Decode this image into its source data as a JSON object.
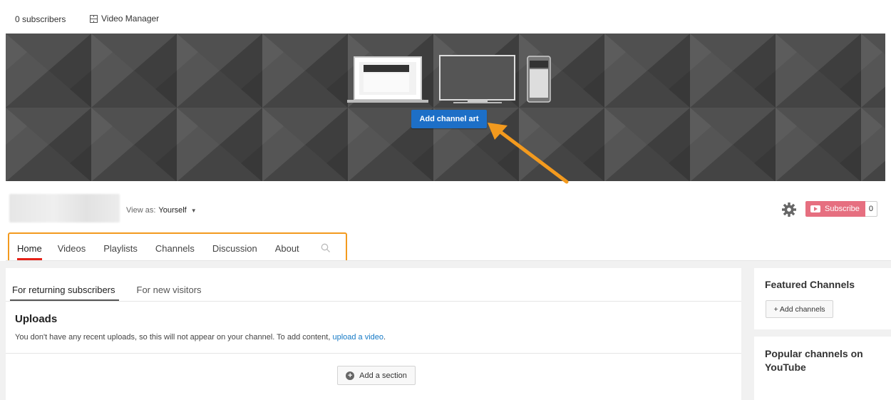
{
  "topbar": {
    "subscribers_label": "0 subscribers",
    "video_manager_label": "Video Manager",
    "video_manager_icon": "film-icon"
  },
  "banner": {
    "add_art_label": "Add channel art",
    "accent_color": "#1d6fc7",
    "devices": [
      "laptop-icon",
      "tv-icon",
      "phone-icon"
    ]
  },
  "channel": {
    "view_as_label": "View as:",
    "view_as_value": "Yourself",
    "subscribe_label": "Subscribe",
    "subscribe_count": "0",
    "subscribe_color": "#e66f80"
  },
  "tabs": [
    {
      "label": "Home",
      "active": true
    },
    {
      "label": "Videos"
    },
    {
      "label": "Playlists"
    },
    {
      "label": "Channels"
    },
    {
      "label": "Discussion"
    },
    {
      "label": "About"
    }
  ],
  "subtabs": [
    {
      "label": "For returning subscribers",
      "active": true
    },
    {
      "label": "For new visitors"
    }
  ],
  "uploads": {
    "title": "Uploads",
    "text": "You don't have any recent uploads, so this will not appear on your channel. To add content,",
    "link": "upload a video"
  },
  "add_section_label": "Add a section",
  "sidebar": {
    "featured_title": "Featured Channels",
    "add_channels_label": "+ Add channels",
    "popular_title": "Popular channels on YouTube"
  },
  "highlight_color": "#f39a1e"
}
